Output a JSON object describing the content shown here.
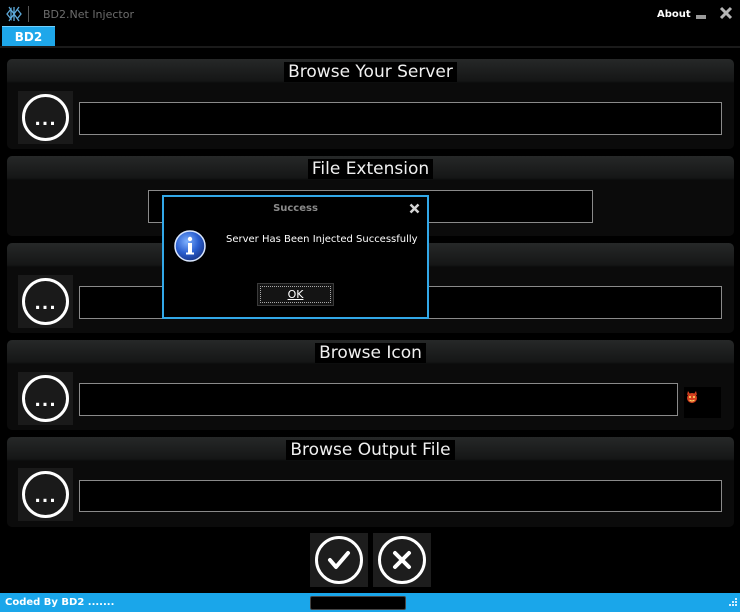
{
  "window": {
    "title": "BD2.Net Injector",
    "about_label": "About"
  },
  "tabs": [
    {
      "label": "BD2"
    }
  ],
  "panels": {
    "server": {
      "title": "Browse Your Server",
      "browse_label": "...",
      "value": ""
    },
    "extension": {
      "title": "File Extension",
      "value": ""
    },
    "third": {
      "browse_label": "...",
      "value": ""
    },
    "icon": {
      "title": "Browse Icon",
      "browse_label": "...",
      "value": ""
    },
    "output": {
      "title": "Browse Output File",
      "browse_label": "...",
      "value": ""
    }
  },
  "actions": {
    "confirm_icon": "check-icon",
    "cancel_icon": "x-icon"
  },
  "statusbar": {
    "text": "Coded By BD2 .......",
    "progress": 0
  },
  "dialog": {
    "title": "Success",
    "message": "Server Has Been Injected Successfully",
    "ok_label": "OK",
    "icon": "info-icon"
  },
  "colors": {
    "accent": "#1ea7ea",
    "background": "#000000",
    "panel": "#0b0b0b"
  }
}
